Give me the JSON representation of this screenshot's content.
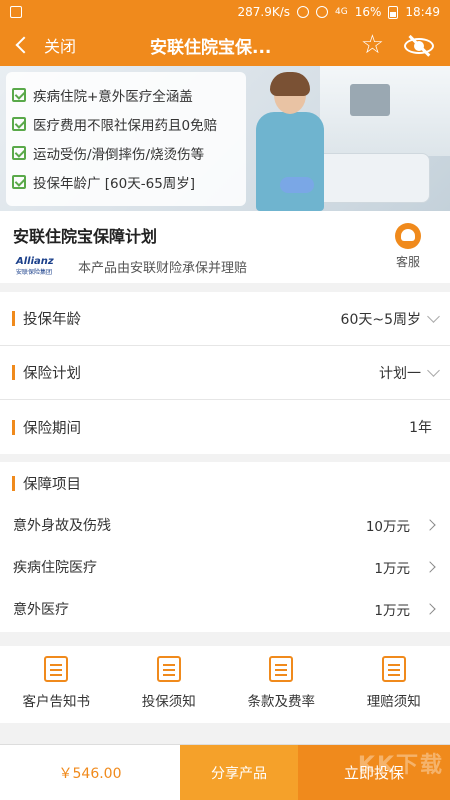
{
  "status_bar": {
    "speed": "287.9K/s",
    "network": "4G",
    "battery": "16%",
    "time": "18:49"
  },
  "nav": {
    "back_label": "关闭",
    "title": "安联住院宝保..."
  },
  "banner": {
    "features": [
      "疾病住院+意外医疗全涵盖",
      "医疗费用不限社保用药且0免赔",
      "运动受伤/滑倒摔伤/烧烫伤等",
      "投保年龄广 [60天-65周岁]"
    ]
  },
  "product": {
    "name": "安联住院宝保障计划",
    "logo_brand": "Allianz",
    "logo_sub": "安联保险集团",
    "underwriter": "本产品由安联财险承保并理赔",
    "service_label": "客服"
  },
  "options": [
    {
      "label": "投保年龄",
      "value": "60天~5周岁"
    },
    {
      "label": "保险计划",
      "value": "计划一"
    },
    {
      "label": "保险期间",
      "value": "1年"
    }
  ],
  "coverage": {
    "title": "保障项目",
    "items": [
      {
        "label": "意外身故及伤残",
        "value": "10万元"
      },
      {
        "label": "疾病住院医疗",
        "value": "1万元"
      },
      {
        "label": "意外医疗",
        "value": "1万元"
      }
    ]
  },
  "docs": [
    {
      "label": "客户告知书",
      "icon": "book-icon"
    },
    {
      "label": "投保须知",
      "icon": "notice-icon"
    },
    {
      "label": "条款及费率",
      "icon": "list-icon"
    },
    {
      "label": "理赔须知",
      "icon": "claim-icon"
    }
  ],
  "bottom": {
    "price": "￥546.00",
    "share_label": "分享产品",
    "buy_label": "立即投保",
    "watermark": "KK下载"
  },
  "colors": {
    "accent": "#f08a1c",
    "share": "#f5a12a",
    "check": "#5aa94a"
  }
}
